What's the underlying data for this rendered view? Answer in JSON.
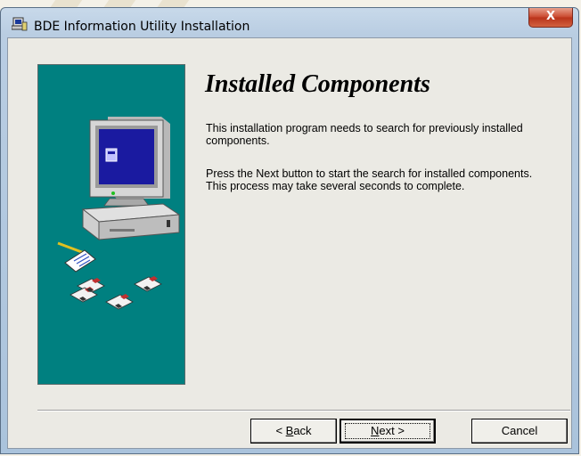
{
  "window": {
    "title": "BDE Information Utility Installation",
    "close_label": "X"
  },
  "page": {
    "heading": "Installed Components",
    "paragraph1": "This installation program needs to search for previously installed components.",
    "paragraph2": "Press the Next button to start the search for installed components. This process may take several seconds to complete."
  },
  "buttons": {
    "back": {
      "prefix": "< ",
      "mnemonic": "B",
      "rest": "ack"
    },
    "next": {
      "mnemonic": "N",
      "rest": "ext >"
    },
    "cancel": "Cancel"
  },
  "colors": {
    "panel": "#008080",
    "title_close": "#c9462c"
  },
  "icons": [
    "setup-app-icon",
    "close-icon",
    "computer-illustration-icon",
    "floppy-disk-icon"
  ]
}
